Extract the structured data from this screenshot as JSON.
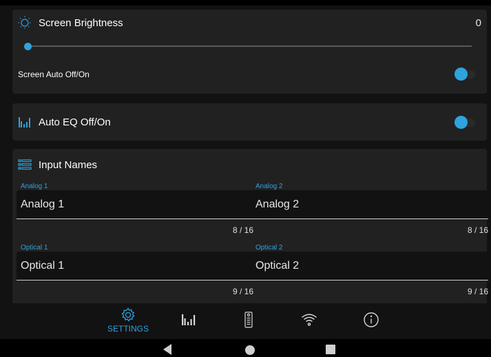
{
  "brightness": {
    "title": "Screen Brightness",
    "value": "0",
    "slider_level": 0,
    "auto_off_label": "Screen Auto Off/On",
    "auto_off_enabled": true
  },
  "auto_eq": {
    "title": "Auto EQ Off/On",
    "enabled": true
  },
  "input_names": {
    "title": "Input Names",
    "fields": [
      {
        "label": "Analog 1",
        "value": "Analog 1",
        "count": "8 / 16"
      },
      {
        "label": "Analog 2",
        "value": "Analog 2",
        "count": "8 / 16"
      },
      {
        "label": "Optical 1",
        "value": "Optical 1",
        "count": "9 / 16"
      },
      {
        "label": "Optical 2",
        "value": "Optical 2",
        "count": "9 / 16"
      }
    ]
  },
  "nav": {
    "settings_label": "SETTINGS",
    "items": [
      "settings-icon",
      "equalizer-icon",
      "remote-icon",
      "wifi-icon",
      "info-icon"
    ]
  },
  "colors": {
    "accent": "#2ea3de",
    "card": "#212121",
    "background": "#121212"
  }
}
